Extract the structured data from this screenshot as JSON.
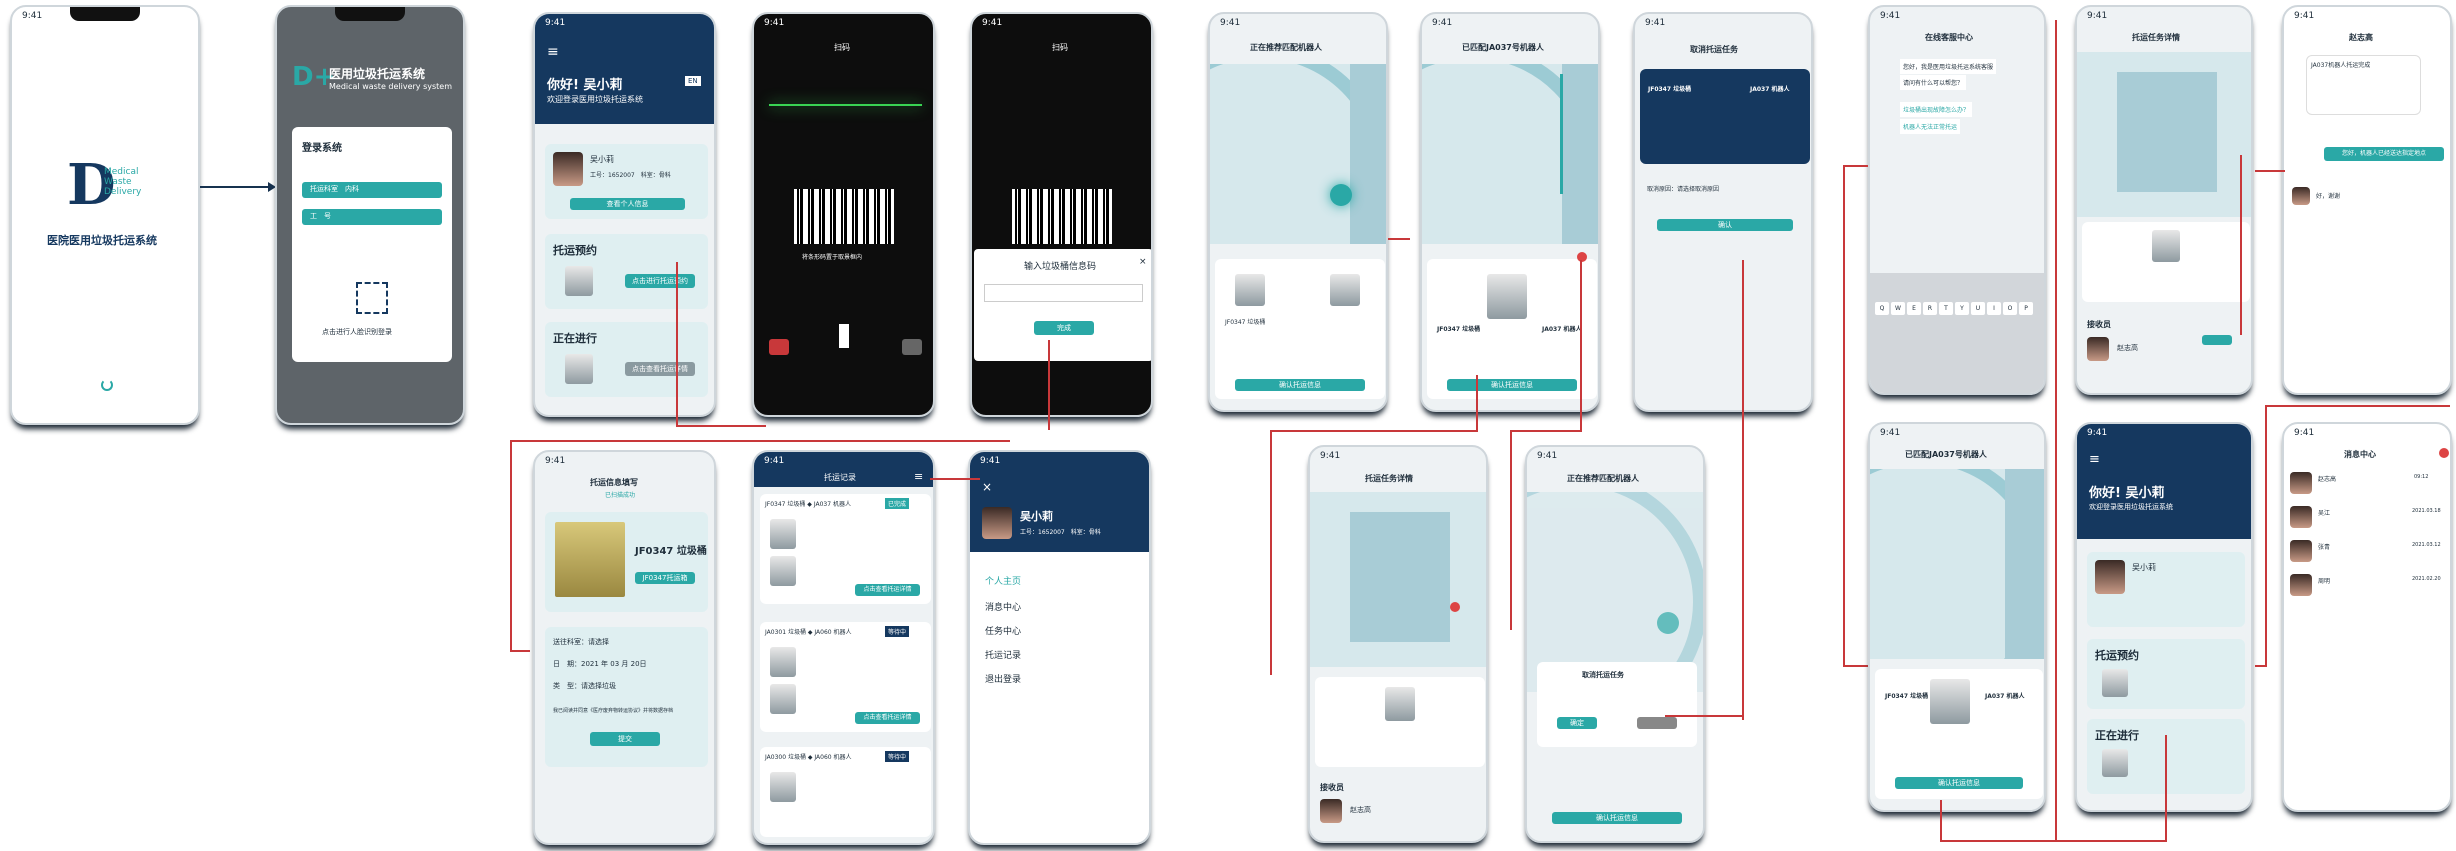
{
  "splash": {
    "time": "9:41",
    "title": "医院医用垃圾托运系统",
    "logo_letter": "D",
    "logo_sub": "Medical Waste Delivery"
  },
  "login": {
    "sys_cn": "医用垃圾托运系统",
    "sys_en": "Medical waste delivery system",
    "login_title": "登录系统",
    "hospital_label": "托运科室",
    "hospital_value": "内科",
    "id_label": "工　号",
    "face_hint": "点击进行人脸识别登录"
  },
  "home": {
    "greet": "你好! 吴小莉",
    "sub": "欢迎登录医用垃圾托运系统",
    "lang": "EN",
    "name": "吴小莉",
    "id_line": "工号：1652007　科室：骨科",
    "profile_btn": "查看个人信息",
    "reserve_title": "托运预约",
    "reserve_btn": "点击进行托运预约",
    "ongoing_title": "正在进行",
    "ongoing_btn": "点击查看托运详情"
  },
  "scan": {
    "title": "扫码",
    "hint": "将条形码置于取景框内",
    "input_title": "输入垃圾桶信息码",
    "confirm": "完成"
  },
  "dispatch": {
    "title": "托运信息填写",
    "status": "已扫描成功",
    "bin": "JF0347 垃圾桶",
    "bin_btn": "JF0347托运箱",
    "dept_label": "送往科室：",
    "dept_value": "请选择",
    "date_label": "日　期：",
    "date_value": "2021 年 03 月 20日",
    "type_label": "类　型：",
    "type_value": "请选择垃圾",
    "agree": "我已阅读并同意《医疗废弃物转运协议》并将数据存档",
    "submit": "提交"
  },
  "records": {
    "title": "托运记录",
    "items": [
      {
        "head": "JF0347 垃圾桶 ◆ JA037 机器人",
        "tag": "已完成"
      },
      {
        "head": "JA0301 垃圾桶 ◆ JA060 机器人",
        "tag": "等待中"
      },
      {
        "head": "JA0300 垃圾桶 ◆ JA060 机器人",
        "tag": "等待中"
      }
    ],
    "detail_btn": "点击查看托运详情"
  },
  "menu": {
    "name": "吴小莉",
    "id_line": "工号：1652007　科室：骨科",
    "items": [
      "个人主页",
      "消息中心",
      "任务中心",
      "托运记录",
      "退出登录"
    ]
  },
  "match": {
    "title1": "正在推荐匹配机器人",
    "title2": "已匹配JA037号机器人",
    "title3": "取消托运任务",
    "bin": "JF0347 垃圾桶",
    "robot": "JA037 机器人",
    "confirm_btn": "确认托运信息",
    "cancel_btn": "确认",
    "reason": "取消原因：",
    "reason_val": "请选择取消原因"
  },
  "task": {
    "title": "托运任务详情",
    "courier": "接收员",
    "courier_name": "赵志高",
    "cancel_title": "取消托运任务",
    "ok": "确定"
  },
  "chat": {
    "title": "在线客服中心",
    "msgs": [
      "您好，我是医用垃圾托运系统客服",
      "请问有什么可以帮您？",
      "垃圾桶出现故障怎么办？",
      "机器人无法正常托运"
    ],
    "kb": "QWERTYUIOP"
  },
  "detail2": {
    "title": "托运任务详情",
    "courier": "接收员",
    "courier_name": "赵志高"
  },
  "chat2": {
    "title": "赵志高",
    "msg1": "JA037机器人托运完成",
    "msg2": "您好，机器人已经送达指定地点",
    "msg3": "好，谢谢"
  },
  "home2": {
    "greet": "你好! 吴小莉",
    "sub": "欢迎登录医用垃圾托运系统",
    "name": "吴小莉",
    "reserve": "托运预约",
    "ongoing": "正在进行"
  },
  "msgs": {
    "title": "消息中心",
    "rows": [
      {
        "name": "赵志高",
        "time": "09:12"
      },
      {
        "name": "吴江",
        "time": "2021.03.18"
      },
      {
        "name": "张青",
        "time": "2021.03.12"
      },
      {
        "name": "周明",
        "time": "2021.02.20"
      }
    ]
  },
  "colors": {
    "navy": "#15385f",
    "teal": "#2aa8a6",
    "red": "#c8383a"
  }
}
